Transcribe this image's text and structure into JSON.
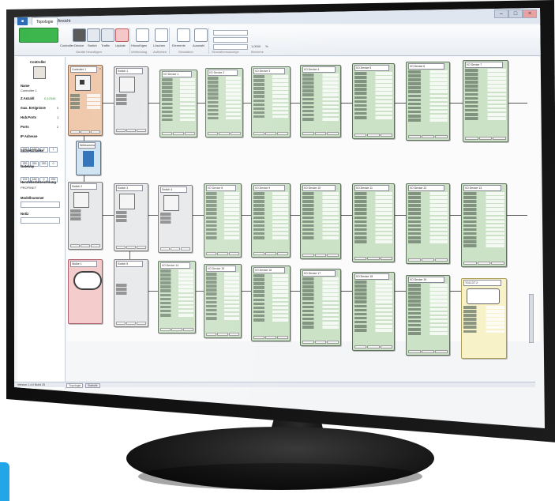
{
  "app": {
    "tabs": [
      "Topologie",
      "Ansicht"
    ],
    "window_controls": [
      "–",
      "□",
      "×"
    ]
  },
  "ribbon": {
    "buttons": [
      {
        "label": "Controller",
        "icon": "controller-icon"
      },
      {
        "label": "Device",
        "icon": "device-icon"
      },
      {
        "label": "Switch",
        "icon": "switch-icon"
      },
      {
        "label": "Traffic",
        "icon": "traffic-icon"
      },
      {
        "label": "Update",
        "icon": "update-icon"
      },
      {
        "label": "Hinzufügen",
        "icon": "add-icon"
      },
      {
        "label": "Löschen",
        "icon": "delete-icon"
      },
      {
        "label": "Elemente",
        "icon": "elements-icon"
      },
      {
        "label": "Auswahl",
        "icon": "select-icon"
      }
    ],
    "groups": [
      "Geräte hinzufügen",
      "Verbindung",
      "Aufheben",
      "Simulation",
      "Simulationsanzeige",
      "Bereiche"
    ],
    "zoom_value": "1,0000",
    "zoom_unit": "%"
  },
  "sidebar": {
    "title": "Controller",
    "fields": [
      {
        "label": "Name",
        "value": "Controller 1"
      },
      {
        "label": "Z.Anzahl",
        "value": "0,12345"
      },
      {
        "label": "max. Ereignisse",
        "value": "0"
      },
      {
        "label": "Hub.Ports",
        "value": "1"
      },
      {
        "label": "Ports",
        "value": "2"
      }
    ],
    "ip_label": "IP Adresse",
    "ip": [
      "192",
      "168",
      "0",
      "1"
    ],
    "subnet_label": "Subnetzmaske",
    "subnet": [
      "255",
      "255",
      "255",
      "0"
    ],
    "gateway_label": "Gateway",
    "gateway": [
      "192",
      "168",
      "0",
      "254"
    ],
    "vendor_label": "Herstellerbezeichnung",
    "vendor": "PROFINET",
    "model_label": "Modellnummer",
    "model": "",
    "notes_label": "Notiz",
    "notes": ""
  },
  "status_bar": {
    "left": "Version 1.4.0 Build 25",
    "tabs": [
      "Topologie",
      "Statistik"
    ]
  },
  "cards": {
    "controller": "Controller 1",
    "switches": [
      "Switch 1",
      "Switch 2",
      "Switch 3",
      "Switch 4",
      "Switch 5"
    ],
    "devices": [
      "I/O Device 1",
      "I/O Device 2",
      "I/O Device 3",
      "I/O Device 4",
      "I/O Device 5",
      "I/O Device 6",
      "I/O Device 7",
      "I/O Device 8",
      "I/O Device 9",
      "I/O Device 10",
      "I/O Device 11",
      "I/O Device 12",
      "I/O Device 13",
      "I/O Device 14",
      "I/O Device 15",
      "I/O Device 16",
      "I/O Device 17",
      "I/O Device 18",
      "I/O Device 19"
    ],
    "cloud": "Wolke 1",
    "traffic": "TGG DT 2",
    "camera": "Webkamera"
  }
}
